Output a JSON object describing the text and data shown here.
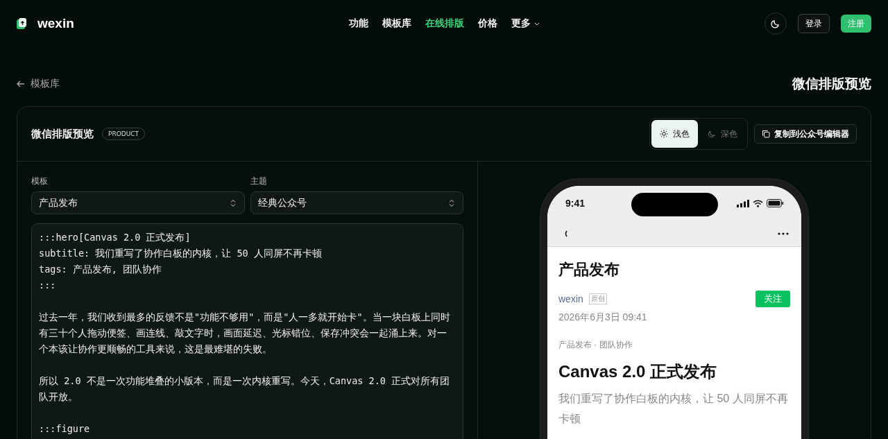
{
  "brand": {
    "name": "wexin"
  },
  "nav": [
    {
      "label": "功能",
      "selected": false
    },
    {
      "label": "模板库",
      "selected": false
    },
    {
      "label": "在线排版",
      "selected": true
    },
    {
      "label": "价格",
      "selected": false
    },
    {
      "label": "更多",
      "selected": false,
      "dropdown": true
    }
  ],
  "header_actions": {
    "login": "登录",
    "signup": "注册"
  },
  "back_link": "模板库",
  "page_title": "微信排版预览",
  "card": {
    "title": "微信排版预览",
    "badge": "PRODUCT",
    "modes": [
      {
        "label": "浅色",
        "kind": "light",
        "selected": true
      },
      {
        "label": "深色",
        "kind": "dark",
        "selected": false
      }
    ],
    "copy_button": "复制到公众号编辑器"
  },
  "fields": [
    {
      "label": "模板",
      "value": "产品发布"
    },
    {
      "label": "主题",
      "value": "经典公众号"
    }
  ],
  "editor": {
    "blocks": [
      [
        ":::hero[Canvas 2.0 正式发布]",
        "subtitle: 我们重写了协作白板的内核，让 50 人同屏不再卡顿",
        "tags: 产品发布, 团队协作",
        ":::"
      ],
      [
        "过去一年，我们收到最多的反馈不是\"功能不够用\"，而是\"人一多就开始卡\"。当一块白板上同时有三十个人拖动便签、画连线、敲文字时，画面延迟、光标错位、保存冲突会一起涌上来。对一个本该让协作更顺畅的工具来说，这是最难堪的失败。"
      ],
      [
        "所以 2.0 不是一次功能堆叠的小版本，而是一次内核重写。今天，Canvas 2.0 正式对所有团队开放。"
      ],
      [
        ":::figure"
      ]
    ]
  },
  "phone": {
    "time": "9:41",
    "article": {
      "title": "产品发布",
      "author": "wexin",
      "original_tag": "原创",
      "follow": "关注",
      "date": "2026年6月3日 09:41",
      "tags": "产品发布 · 团队协作",
      "hero_title": "Canvas 2.0 正式发布",
      "subtitle": "我们重写了协作白板的内核，让 50 人同屏不再卡顿"
    }
  }
}
